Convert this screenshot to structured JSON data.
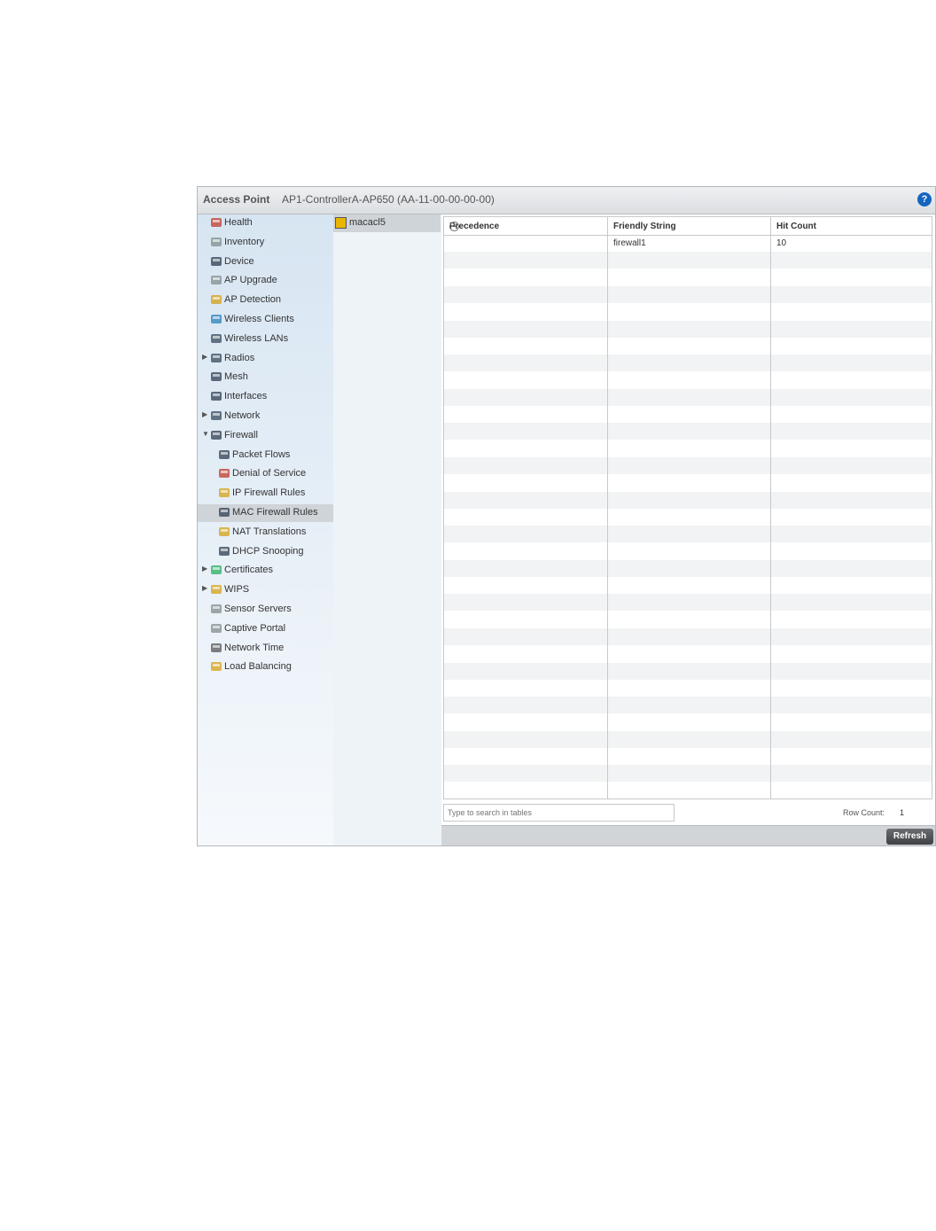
{
  "header": {
    "title_label": "Access Point",
    "title_value": "AP1-ControllerA-AP650 (AA-11-00-00-00-00)",
    "help_symbol": "?"
  },
  "sidebar": {
    "items": [
      {
        "label": "Health",
        "icon": "heart-icon",
        "indent": 0,
        "arrow": ""
      },
      {
        "label": "Inventory",
        "icon": "inventory-icon",
        "indent": 0,
        "arrow": ""
      },
      {
        "label": "Device",
        "icon": "device-icon",
        "indent": 0,
        "arrow": ""
      },
      {
        "label": "AP Upgrade",
        "icon": "upgrade-icon",
        "indent": 0,
        "arrow": ""
      },
      {
        "label": "AP Detection",
        "icon": "detection-icon",
        "indent": 0,
        "arrow": ""
      },
      {
        "label": "Wireless Clients",
        "icon": "clients-icon",
        "indent": 0,
        "arrow": ""
      },
      {
        "label": "Wireless LANs",
        "icon": "wlan-icon",
        "indent": 0,
        "arrow": ""
      },
      {
        "label": "Radios",
        "icon": "antenna-icon",
        "indent": 0,
        "arrow": "▶"
      },
      {
        "label": "Mesh",
        "icon": "mesh-icon",
        "indent": 0,
        "arrow": ""
      },
      {
        "label": "Interfaces",
        "icon": "interfaces-icon",
        "indent": 0,
        "arrow": ""
      },
      {
        "label": "Network",
        "icon": "network-icon",
        "indent": 0,
        "arrow": "▶"
      },
      {
        "label": "Firewall",
        "icon": "firewall-icon",
        "indent": 0,
        "arrow": "▼"
      },
      {
        "label": "Packet Flows",
        "icon": "packet-flows-icon",
        "indent": 1,
        "arrow": ""
      },
      {
        "label": "Denial of Service",
        "icon": "dos-icon",
        "indent": 1,
        "arrow": ""
      },
      {
        "label": "IP Firewall Rules",
        "icon": "ip-rules-icon",
        "indent": 1,
        "arrow": ""
      },
      {
        "label": "MAC Firewall Rules",
        "icon": "mac-rules-icon",
        "indent": 1,
        "arrow": "",
        "selected": true
      },
      {
        "label": "NAT Translations",
        "icon": "nat-icon",
        "indent": 1,
        "arrow": ""
      },
      {
        "label": "DHCP Snooping",
        "icon": "dhcp-icon",
        "indent": 1,
        "arrow": ""
      },
      {
        "label": "Certificates",
        "icon": "certificate-icon",
        "indent": 0,
        "arrow": "▶"
      },
      {
        "label": "WIPS",
        "icon": "wips-icon",
        "indent": 0,
        "arrow": "▶"
      },
      {
        "label": "Sensor Servers",
        "icon": "sensor-icon",
        "indent": 0,
        "arrow": ""
      },
      {
        "label": "Captive Portal",
        "icon": "portal-icon",
        "indent": 0,
        "arrow": ""
      },
      {
        "label": "Network Time",
        "icon": "clock-icon",
        "indent": 0,
        "arrow": ""
      },
      {
        "label": "Load Balancing",
        "icon": "balance-icon",
        "indent": 0,
        "arrow": ""
      }
    ]
  },
  "list": {
    "selected_item": "macacl5"
  },
  "table": {
    "columns": [
      "Precedence",
      "Friendly String",
      "Hit Count"
    ],
    "rows": [
      {
        "precedence": "",
        "friendly_string": "firewall1",
        "hit_count": "10"
      }
    ],
    "sort_symbol": "▲"
  },
  "search": {
    "placeholder": "Type to search in tables"
  },
  "row_count": {
    "label": "Row Count:",
    "value": "1"
  },
  "footer": {
    "refresh_label": "Refresh"
  },
  "colors": {
    "selection": "#cfd4d9",
    "help": "#1565c0"
  }
}
